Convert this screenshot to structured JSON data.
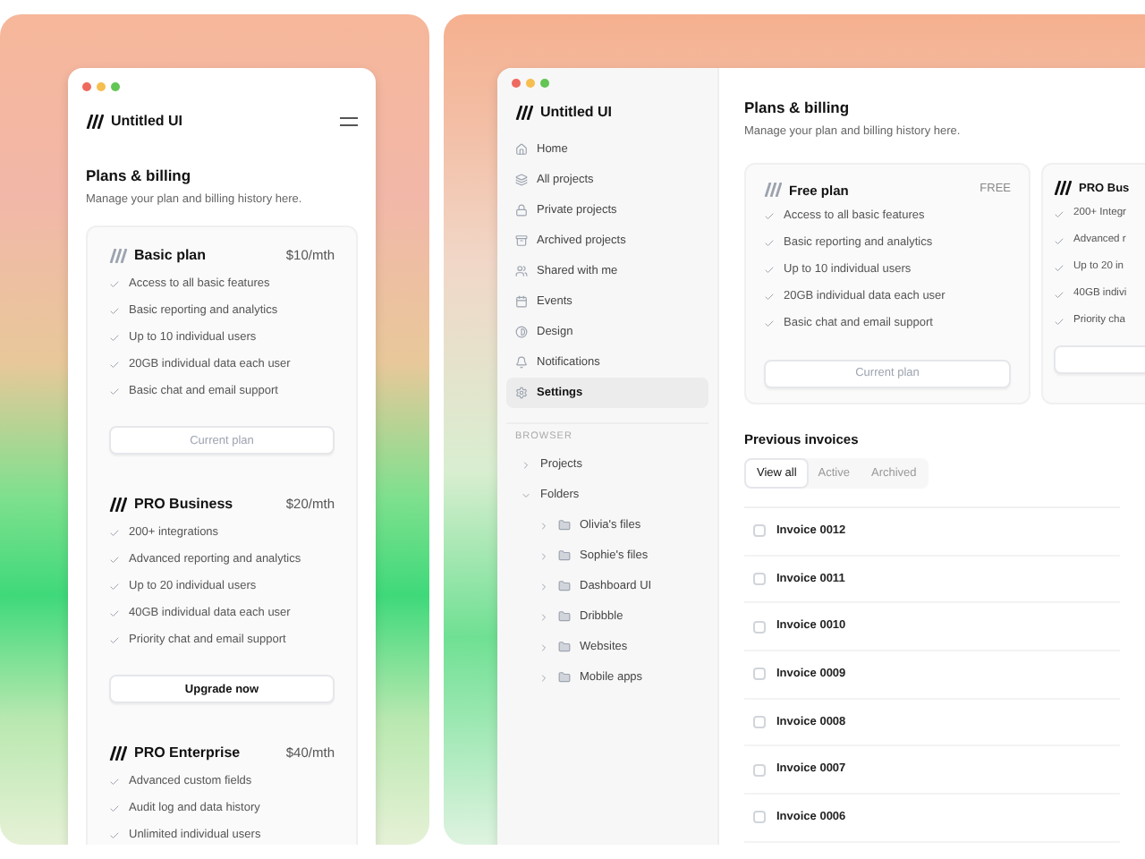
{
  "mobile": {
    "app_name": "Untitled UI",
    "title": "Plans & billing",
    "subtitle": "Manage your plan and billing history here.",
    "plans": [
      {
        "name": "Basic plan",
        "price": "$10/mth",
        "features": [
          "Access to all basic features",
          "Basic reporting and analytics",
          "Up to 10 individual users",
          "20GB individual data each user",
          "Basic chat and email support"
        ],
        "button": {
          "label": "Current plan",
          "disabled": true
        }
      },
      {
        "name": "PRO Business",
        "price": "$20/mth",
        "features": [
          "200+ integrations",
          "Advanced reporting and analytics",
          "Up to 20 individual users",
          "40GB individual data each user",
          "Priority chat and email support"
        ],
        "button": {
          "label": "Upgrade now",
          "disabled": false
        }
      },
      {
        "name": "PRO Enterprise",
        "price": "$40/mth",
        "features": [
          "Advanced custom fields",
          "Audit log and data history",
          "Unlimited individual users"
        ]
      }
    ]
  },
  "desktop": {
    "app_name": "Untitled UI",
    "nav": [
      {
        "label": "Home",
        "selected": false
      },
      {
        "label": "All projects",
        "selected": false
      },
      {
        "label": "Private projects",
        "selected": false
      },
      {
        "label": "Archived projects",
        "selected": false
      },
      {
        "label": "Shared with me",
        "selected": false
      },
      {
        "label": "Events",
        "selected": false
      },
      {
        "label": "Design",
        "selected": false
      },
      {
        "label": "Notifications",
        "selected": false
      },
      {
        "label": "Settings",
        "selected": true
      }
    ],
    "browser": {
      "heading": "BROWSER",
      "tree": [
        {
          "label": "Projects",
          "expanded": false
        },
        {
          "label": "Folders",
          "expanded": true,
          "children": [
            {
              "label": "Olivia's files",
              "expanded": false
            },
            {
              "label": "Sophie's files",
              "expanded": false
            },
            {
              "label": "Dashboard UI",
              "expanded": false
            },
            {
              "label": "Dribbble",
              "expanded": false
            },
            {
              "label": "Websites",
              "expanded": false
            },
            {
              "label": "Mobile apps",
              "expanded": false
            }
          ]
        }
      ]
    },
    "title": "Plans & billing",
    "subtitle": "Manage your plan and billing history here.",
    "plans": [
      {
        "name": "Free plan",
        "price": "FREE",
        "features": [
          "Access to all basic features",
          "Basic reporting and analytics",
          "Up to 10 individual users",
          "20GB individual data each user",
          "Basic chat and email support"
        ],
        "button": {
          "label": "Current plan",
          "disabled": true
        }
      },
      {
        "name": "PRO Bus",
        "features": [
          "200+ Integr",
          "Advanced r",
          "Up to 20 in",
          "40GB indivi",
          "Priority cha"
        ]
      }
    ],
    "invoices": {
      "title": "Previous invoices",
      "tabs": [
        {
          "label": "View all",
          "selected": true
        },
        {
          "label": "Active",
          "selected": false
        },
        {
          "label": "Archived",
          "selected": false
        }
      ],
      "rows": [
        {
          "label": "Invoice 0012",
          "checked": false
        },
        {
          "label": "Invoice 0011",
          "checked": false
        },
        {
          "label": "Invoice 0010",
          "checked": false
        },
        {
          "label": "Invoice 0009",
          "checked": false
        },
        {
          "label": "Invoice 0008",
          "checked": false
        },
        {
          "label": "Invoice 0007",
          "checked": false
        },
        {
          "label": "Invoice 0006",
          "checked": false
        }
      ]
    }
  }
}
